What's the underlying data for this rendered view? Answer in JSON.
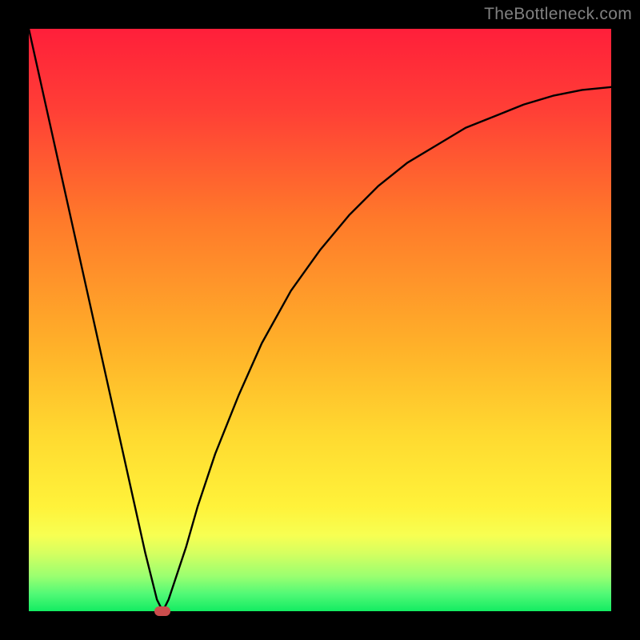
{
  "watermark": "TheBottleneck.com",
  "colors": {
    "curve": "#000000",
    "marker": "#cb4d4d",
    "frame": "#000000"
  },
  "chart_data": {
    "type": "line",
    "title": "",
    "xlabel": "",
    "ylabel": "",
    "xlim": [
      0,
      100
    ],
    "ylim": [
      0,
      100
    ],
    "grid": false,
    "legend": false,
    "annotations": [],
    "x": [
      0,
      2,
      4,
      6,
      8,
      10,
      12,
      14,
      16,
      18,
      20,
      22,
      23,
      24,
      25,
      27,
      29,
      32,
      36,
      40,
      45,
      50,
      55,
      60,
      65,
      70,
      75,
      80,
      85,
      90,
      95,
      100
    ],
    "values": [
      100,
      91,
      82,
      73,
      64,
      55,
      46,
      37,
      28,
      19,
      10,
      2,
      0,
      2,
      5,
      11,
      18,
      27,
      37,
      46,
      55,
      62,
      68,
      73,
      77,
      80,
      83,
      85,
      87,
      88.5,
      89.5,
      90
    ],
    "min_point": {
      "x": 23,
      "y": 0
    }
  }
}
